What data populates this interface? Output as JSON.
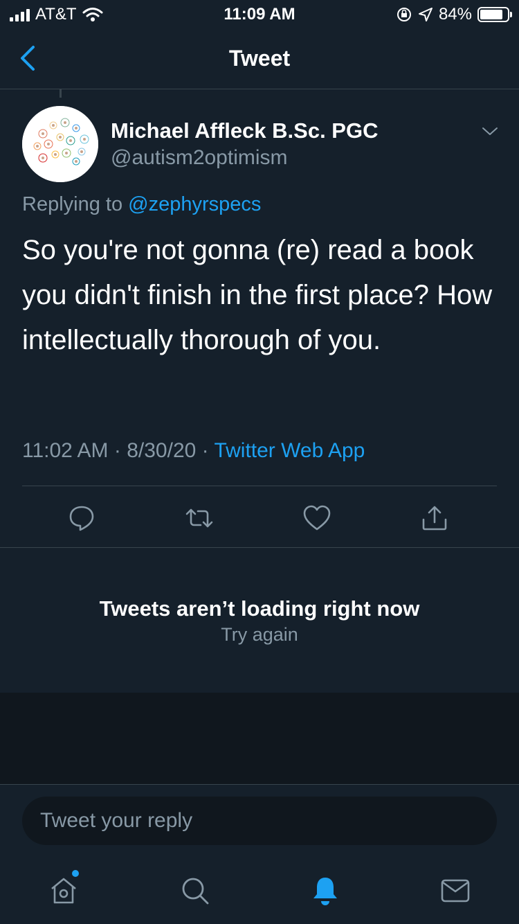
{
  "status_bar": {
    "carrier": "AT&T",
    "time": "11:09 AM",
    "battery_percent": "84%",
    "battery_level": 0.84
  },
  "nav": {
    "title": "Tweet",
    "back_icon": "chevron-left-icon"
  },
  "tweet": {
    "author_name": "Michael Affleck B.Sc. PGC",
    "author_handle": "@autism2optimism",
    "replying_prefix": "Replying to",
    "replying_to": "@zephyrspecs",
    "text": "So you're not gonna (re) read a book you didn't finish in the first place? How intellectually thorough of you.",
    "time": "11:02 AM",
    "date": "8/30/20",
    "separator": "·",
    "source": "Twitter Web App",
    "actions": [
      "reply-icon",
      "retweet-icon",
      "like-icon",
      "share-icon"
    ]
  },
  "error": {
    "title": "Tweets aren’t loading right now",
    "retry": "Try again"
  },
  "composer": {
    "placeholder": "Tweet your reply"
  },
  "tabs": [
    "home-icon",
    "search-icon",
    "notifications-icon",
    "messages-icon"
  ],
  "colors": {
    "background": "#15202b",
    "accent": "#1da1f2",
    "secondary_text": "#8899a6",
    "border": "#38444d"
  }
}
